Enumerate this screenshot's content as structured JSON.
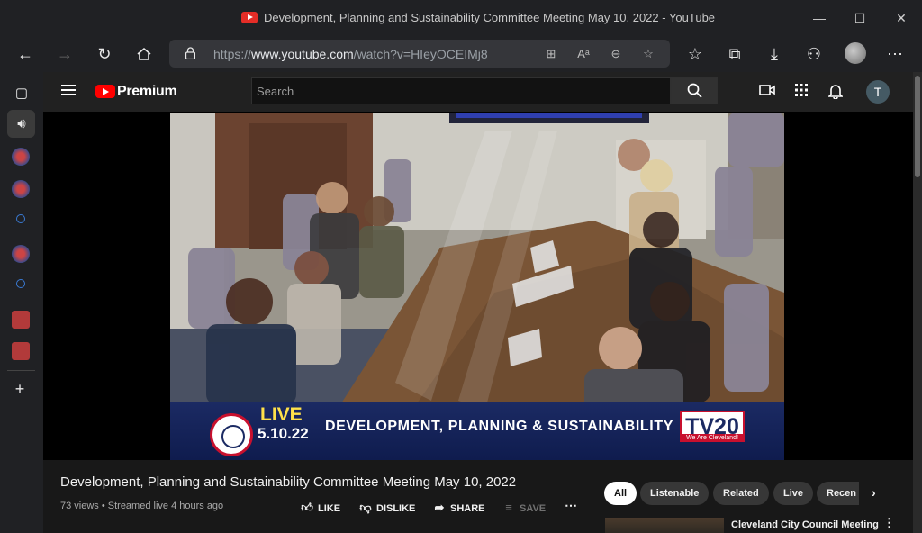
{
  "window": {
    "title": "Development, Planning and Sustainability Committee Meeting May 10, 2022 - YouTube",
    "minimize": "—",
    "maximize": "☐",
    "close": "✕"
  },
  "browser": {
    "url_prefix": "https://",
    "url_host": "www.youtube.com",
    "url_path": "/watch?v=HIeyOCEIMj8"
  },
  "youtube": {
    "brand": "Premium",
    "search_placeholder": "Search",
    "account_initial": "T"
  },
  "video": {
    "overlay_live": "LIVE",
    "overlay_date": "5.10.22",
    "overlay_committee": "DEVELOPMENT, PLANNING & SUSTAINABILITY",
    "overlay_station": "TV20",
    "overlay_station_tag": "We Are Cleveland!",
    "title": "Development, Planning and Sustainability Committee Meeting May 10, 2022",
    "meta": "73 views • Streamed live 4 hours ago",
    "actions": {
      "like": "LIKE",
      "dislike": "DISLIKE",
      "share": "SHARE",
      "save": "SAVE"
    }
  },
  "chips": [
    "All",
    "Listenable",
    "Related",
    "Live",
    "Recen"
  ],
  "suggestion": {
    "title": "Cleveland City Council Meeting"
  }
}
